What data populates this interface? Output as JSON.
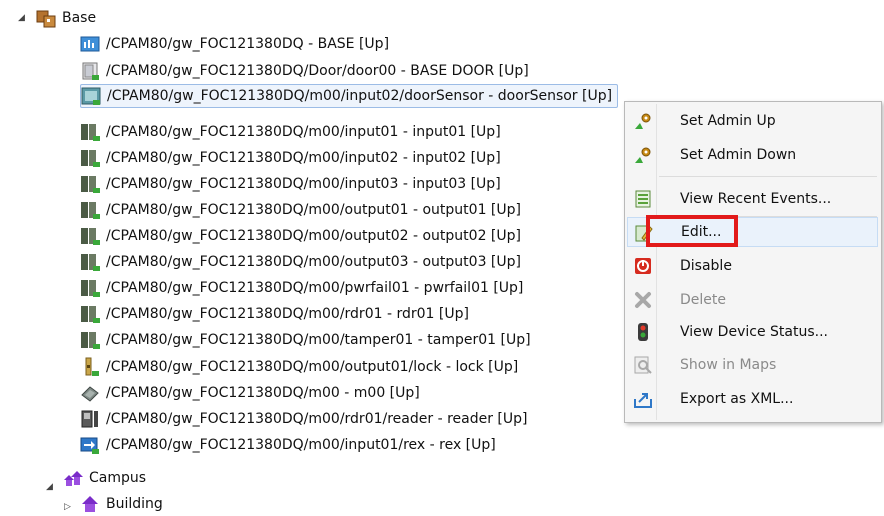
{
  "tree": {
    "root": {
      "label": "Base"
    },
    "items": [
      {
        "label": "/CPAM80/gw_FOC121380DQ - BASE [Up]",
        "icon": "gateway-icon"
      },
      {
        "label": "/CPAM80/gw_FOC121380DQ/Door/door00 - BASE DOOR [Up]",
        "icon": "door-icon"
      },
      {
        "label": "/CPAM80/gw_FOC121380DQ/m00/input02/doorSensor - doorSensor [Up]",
        "icon": "door-sensor-icon"
      },
      {
        "label": "/CPAM80/gw_FOC121380DQ/m00/input01 - input01 [Up]",
        "icon": "io-module-icon"
      },
      {
        "label": "/CPAM80/gw_FOC121380DQ/m00/input02 - input02 [Up]",
        "icon": "io-module-icon"
      },
      {
        "label": "/CPAM80/gw_FOC121380DQ/m00/input03 - input03 [Up]",
        "icon": "io-module-icon"
      },
      {
        "label": "/CPAM80/gw_FOC121380DQ/m00/output01 - output01 [Up]",
        "icon": "io-module-icon"
      },
      {
        "label": "/CPAM80/gw_FOC121380DQ/m00/output02 - output02 [Up]",
        "icon": "io-module-icon"
      },
      {
        "label": "/CPAM80/gw_FOC121380DQ/m00/output03 - output03 [Up]",
        "icon": "io-module-icon"
      },
      {
        "label": "/CPAM80/gw_FOC121380DQ/m00/pwrfail01 - pwrfail01 [Up]",
        "icon": "io-module-icon"
      },
      {
        "label": "/CPAM80/gw_FOC121380DQ/m00/rdr01 - rdr01 [Up]",
        "icon": "io-module-icon"
      },
      {
        "label": "/CPAM80/gw_FOC121380DQ/m00/tamper01 - tamper01 [Up]",
        "icon": "io-module-icon"
      },
      {
        "label": "/CPAM80/gw_FOC121380DQ/m00/output01/lock - lock [Up]",
        "icon": "lock-icon"
      },
      {
        "label": "/CPAM80/gw_FOC121380DQ/m00 - m00 [Up]",
        "icon": "module-icon"
      },
      {
        "label": "/CPAM80/gw_FOC121380DQ/m00/rdr01/reader - reader [Up]",
        "icon": "reader-icon"
      },
      {
        "label": "/CPAM80/gw_FOC121380DQ/m00/input01/rex - rex [Up]",
        "icon": "rex-icon"
      }
    ],
    "campus": {
      "label": "Campus"
    },
    "building": {
      "label": "Building"
    }
  },
  "context_menu": {
    "items": [
      {
        "label": "Set Admin Up",
        "icon": "admin-up-icon",
        "enabled": true
      },
      {
        "label": "Set Admin Down",
        "icon": "admin-down-icon",
        "enabled": true
      },
      {
        "label": "View Recent Events...",
        "icon": "events-icon",
        "enabled": true
      },
      {
        "label": "Edit...",
        "icon": "edit-icon",
        "enabled": true
      },
      {
        "label": "Disable",
        "icon": "disable-icon",
        "enabled": true
      },
      {
        "label": "Delete",
        "icon": "delete-icon",
        "enabled": false
      },
      {
        "label": "View Device Status...",
        "icon": "status-icon",
        "enabled": true
      },
      {
        "label": "Show in Maps",
        "icon": "maps-icon",
        "enabled": false
      },
      {
        "label": "Export as XML...",
        "icon": "export-icon",
        "enabled": true
      }
    ]
  },
  "colors": {
    "highlight_box": "#e21a1a",
    "selection_bg": "#eef4fc",
    "selection_border": "#9cbce6",
    "disabled_text": "#8a8a8a"
  }
}
